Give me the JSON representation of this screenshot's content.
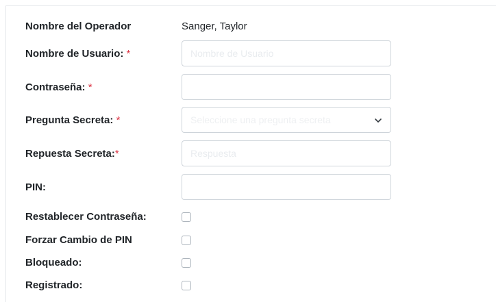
{
  "form": {
    "operator": {
      "label": "Nombre del Operador",
      "value": "Sanger, Taylor"
    },
    "username": {
      "label": "Nombre de Usuario:",
      "required_mark": "*",
      "value": "",
      "placeholder": "Nombre de Usuario"
    },
    "password": {
      "label": "Contraseña:",
      "required_mark": "*",
      "value": "",
      "placeholder": ""
    },
    "secret_question": {
      "label": "Pregunta Secreta:",
      "required_mark": "*",
      "selected": "Seleccione una pregunta secreta",
      "icon": "chevron-down-icon"
    },
    "secret_answer": {
      "label": "Repuesta Secreta:",
      "required_mark": "*",
      "value": "",
      "placeholder": "Respuesta"
    },
    "pin": {
      "label": "PIN:",
      "value": "",
      "placeholder": ""
    },
    "reset_password": {
      "label": "Restablecer Contraseña:",
      "checked": false
    },
    "force_pin_change": {
      "label": "Forzar Cambio de PIN",
      "checked": false
    },
    "locked": {
      "label": "Bloqueado:",
      "checked": false
    },
    "registered": {
      "label": "Registrado:",
      "checked": false
    }
  },
  "colors": {
    "required": "#dc3545",
    "border": "#ced4da",
    "text": "#212529"
  }
}
